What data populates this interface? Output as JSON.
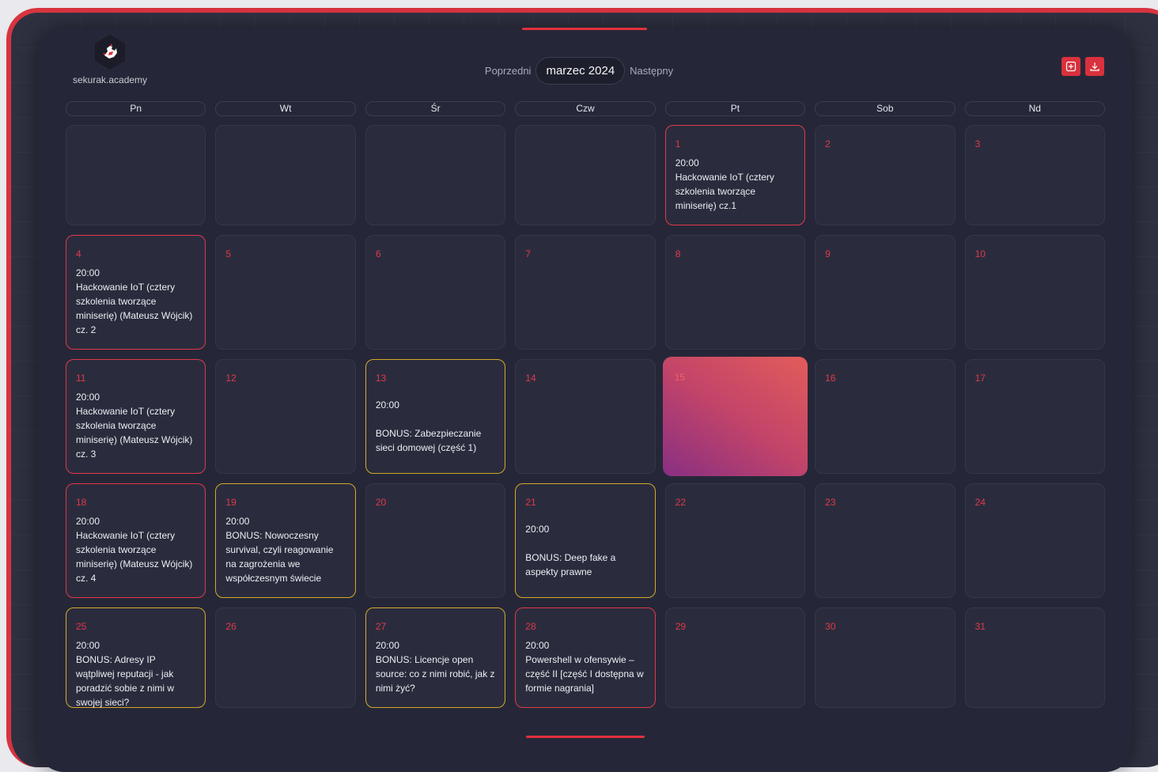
{
  "brand": {
    "name": "sekurak.academy",
    "logo_icon": "rooster-logo-icon"
  },
  "nav": {
    "prev": "Poprzedni",
    "month": "marzec 2024",
    "next": "Następny"
  },
  "toolbar": {
    "add_icon": "plus-square-icon",
    "download_icon": "download-icon",
    "accent": "#d9313d"
  },
  "weekdays": [
    "Pn",
    "Wt",
    "Śr",
    "Czw",
    "Pt",
    "Sob",
    "Nd"
  ],
  "days": {
    "d1": {
      "num": "1",
      "time": "20:00",
      "title": "Hackowanie IoT (cztery szkolenia tworzące miniserię) cz.1"
    },
    "d2": {
      "num": "2"
    },
    "d3": {
      "num": "3"
    },
    "d4": {
      "num": "4",
      "time": "20:00",
      "title": "Hackowanie IoT (cztery szkolenia tworzące miniserię) (Mateusz Wójcik) cz. 2"
    },
    "d5": {
      "num": "5"
    },
    "d6": {
      "num": "6"
    },
    "d7": {
      "num": "7"
    },
    "d8": {
      "num": "8"
    },
    "d9": {
      "num": "9"
    },
    "d10": {
      "num": "10"
    },
    "d11": {
      "num": "11",
      "time": "20:00",
      "title": "Hackowanie IoT (cztery szkolenia tworzące miniserię) (Mateusz Wójcik) cz. 3"
    },
    "d12": {
      "num": "12"
    },
    "d13": {
      "num": "13",
      "time": "20:00",
      "title": "BONUS: Zabezpieczanie sieci domowej (część 1)"
    },
    "d14": {
      "num": "14"
    },
    "d15": {
      "num": "15"
    },
    "d16": {
      "num": "16"
    },
    "d17": {
      "num": "17"
    },
    "d18": {
      "num": "18",
      "time": "20:00",
      "title": "Hackowanie IoT (cztery szkolenia tworzące miniserię) (Mateusz Wójcik) cz. 4"
    },
    "d19": {
      "num": "19",
      "time": "20:00",
      "title": "BONUS: Nowoczesny survival, czyli reagowanie na zagrożenia we współczesnym świecie"
    },
    "d20": {
      "num": "20"
    },
    "d21": {
      "num": "21",
      "time": "20:00",
      "title": "BONUS: Deep fake a aspekty prawne"
    },
    "d22": {
      "num": "22"
    },
    "d23": {
      "num": "23"
    },
    "d24": {
      "num": "24"
    },
    "d25": {
      "num": "25",
      "time": "20:00",
      "title": "BONUS: Adresy IP wątpliwej reputacji - jak poradzić sobie z nimi w swojej sieci?"
    },
    "d26": {
      "num": "26"
    },
    "d27": {
      "num": "27",
      "time": "20:00",
      "title": "BONUS: Licencje open source: co z nimi robić, jak z nimi żyć?"
    },
    "d28": {
      "num": "28",
      "time": "20:00",
      "title": "Powershell w ofensywie – część II [część I dostępna w formie nagrania]"
    },
    "d29": {
      "num": "29"
    },
    "d30": {
      "num": "30"
    },
    "d31": {
      "num": "31"
    }
  },
  "colors": {
    "event_red": "#e0394a",
    "event_gold": "#d4a92a",
    "background": "#252738"
  }
}
